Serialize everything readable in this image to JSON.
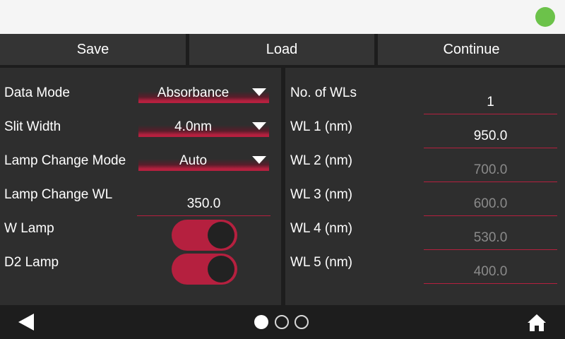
{
  "status": {
    "indicator_color": "#6cc24a"
  },
  "toolbar": {
    "save_label": "Save",
    "load_label": "Load",
    "continue_label": "Continue"
  },
  "left_panel": {
    "data_mode": {
      "label": "Data Mode",
      "value": "Absorbance"
    },
    "slit_width": {
      "label": "Slit Width",
      "value": "4.0nm"
    },
    "lamp_change_mode": {
      "label": "Lamp Change Mode",
      "value": "Auto"
    },
    "lamp_change_wl": {
      "label": "Lamp Change WL",
      "value": "350.0"
    },
    "w_lamp": {
      "label": "W Lamp",
      "on": true
    },
    "d2_lamp": {
      "label": "D2 Lamp",
      "on": true
    }
  },
  "right_panel": {
    "no_of_wls": {
      "label": "No. of WLs",
      "value": "1"
    },
    "wavelengths": [
      {
        "label": "WL 1 (nm)",
        "value": "950.0",
        "enabled": true
      },
      {
        "label": "WL 2 (nm)",
        "value": "700.0",
        "enabled": false
      },
      {
        "label": "WL 3 (nm)",
        "value": "600.0",
        "enabled": false
      },
      {
        "label": "WL 4 (nm)",
        "value": "530.0",
        "enabled": false
      },
      {
        "label": "WL 5 (nm)",
        "value": "400.0",
        "enabled": false
      }
    ]
  },
  "nav": {
    "page_current": 1,
    "page_count": 3,
    "icons": {
      "back": "back-arrow-icon",
      "home": "home-icon"
    }
  },
  "colors": {
    "accent": "#b5203f",
    "background": "#2e2e2e",
    "bar": "#1d1d1d",
    "status_ok": "#6cc24a"
  }
}
